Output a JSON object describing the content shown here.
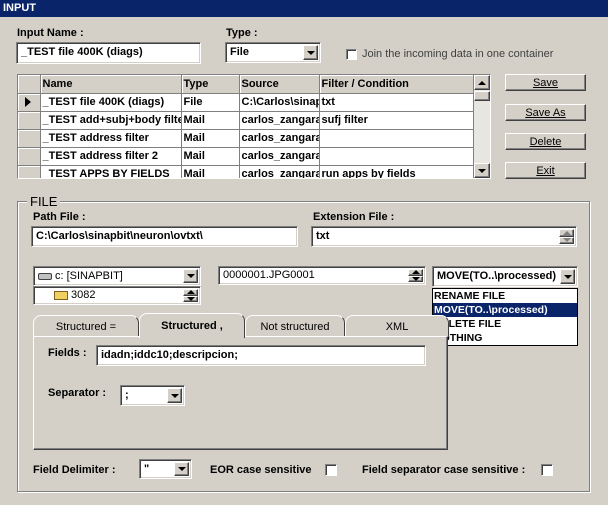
{
  "window": {
    "title": "INPUT"
  },
  "input_name": {
    "label": "Input Name :",
    "value": "_TEST  file 400K (diags)"
  },
  "type": {
    "label": "Type :",
    "value": "File"
  },
  "join": {
    "label": "Join the incoming data in one container",
    "checked": false
  },
  "grid": {
    "columns": [
      "Name",
      "Type",
      "Source",
      "Filter / Condition"
    ],
    "rows": [
      {
        "name": "_TEST  file 400K (diags)",
        "type": "File",
        "source": "C:\\Carlos\\sinapbit",
        "filter": "txt",
        "current": true
      },
      {
        "name": "_TEST add+subj+body filter",
        "type": "Mail",
        "source": "carlos_zangara",
        "filter": "sufj filter",
        "current": false
      },
      {
        "name": "_TEST address filter",
        "type": "Mail",
        "source": "carlos_zangara",
        "filter": "",
        "current": false
      },
      {
        "name": "_TEST address filter 2",
        "type": "Mail",
        "source": "carlos_zangara",
        "filter": "",
        "current": false
      },
      {
        "name": "_TEST APPS BY FIELDS",
        "type": "Mail",
        "source": "carlos_zangara",
        "filter": "run apps by fields",
        "current": false
      }
    ]
  },
  "buttons": {
    "save": "Save",
    "save_as": "Save As",
    "delete": "Delete",
    "exit": "Exit"
  },
  "file_section": {
    "title": "FILE",
    "path_label": "Path File :",
    "path_value": "C:\\Carlos\\sinapbit\\neuron\\ovtxt\\",
    "ext_label": "Extension File :",
    "ext_value": "txt",
    "drive_value": "c: [SINAPBIT]",
    "folder_value": "3082",
    "file_value": "0000001.JPG0001",
    "action_value": "MOVE(TO..\\processed)",
    "action_options": [
      "RENAME FILE",
      "MOVE(TO..\\processed)",
      "DELETE FILE",
      "NOTHING"
    ],
    "action_selected_index": 1
  },
  "tabs": [
    {
      "label": "Structured =",
      "active": false
    },
    {
      "label": "Structured ,",
      "active": true
    },
    {
      "label": "Not structured",
      "active": false
    },
    {
      "label": "XML",
      "active": false
    }
  ],
  "tab_content": {
    "fields_label": "Fields :",
    "fields_value": "idadn;iddc10;descripcion;",
    "separator_label": "Separator :",
    "separator_value": ";"
  },
  "bottom": {
    "field_delim_label": "Field Delimiter :",
    "field_delim_value": "\"",
    "eor_label": "EOR case sensitive",
    "eor_checked": false,
    "fsep_label": "Field separator case sensitive :",
    "fsep_checked": false
  }
}
